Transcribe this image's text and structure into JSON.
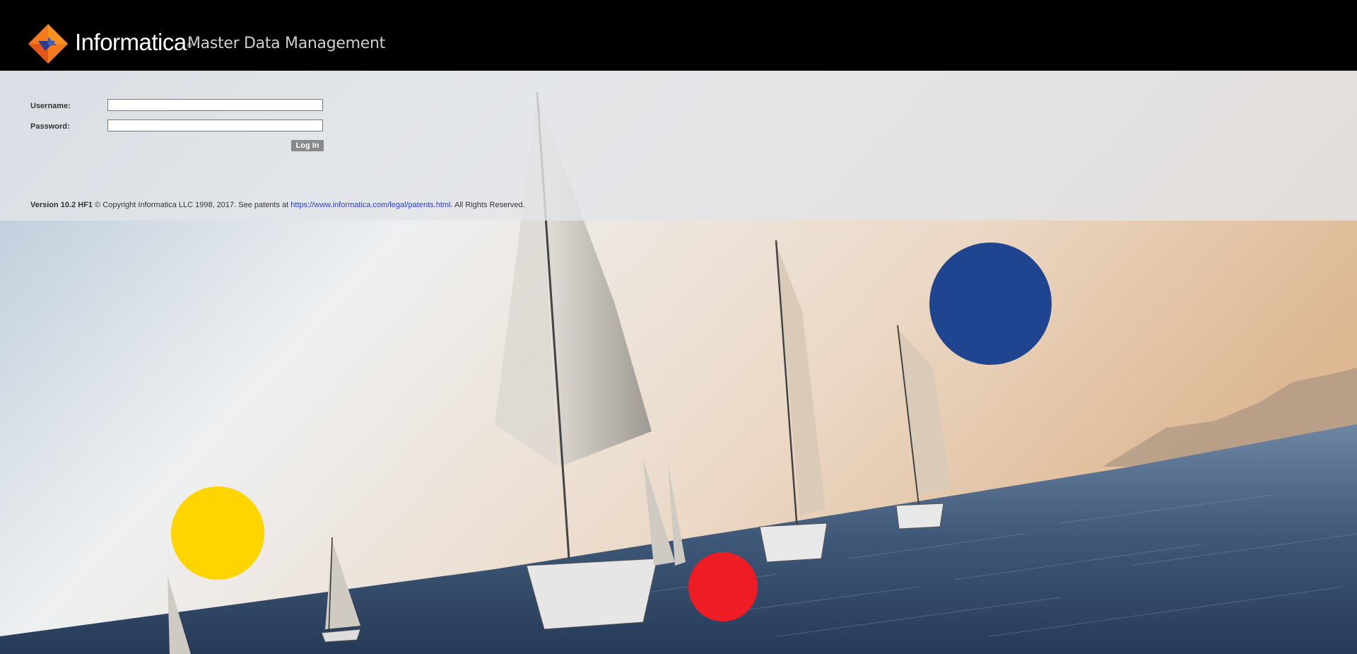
{
  "header": {
    "brand_name": "Informatica",
    "brand_mark": "®",
    "product_name": "Master Data Management",
    "logo_icon": "informatica-diamond-logo"
  },
  "login_form": {
    "username_label": "Username:",
    "password_label": "Password:",
    "username_value": "",
    "password_value": "",
    "login_button_label": "Log In"
  },
  "footer": {
    "version": "Version 10.2 HF1",
    "copyright": "© Copyright Informatica LLC 1998, 2017. See patents at",
    "patents_link": "https://www.informatica.com/legal/patents.html",
    "rights": ". All Rights Reserved."
  },
  "colors": {
    "header_bg": "#000000",
    "logo_orange": "#f47a20",
    "logo_blue": "#2d3a8c",
    "circle_blue": "#1f4490",
    "circle_yellow": "#ffd500",
    "circle_red": "#ee1c24",
    "link": "#2a3fd0"
  }
}
